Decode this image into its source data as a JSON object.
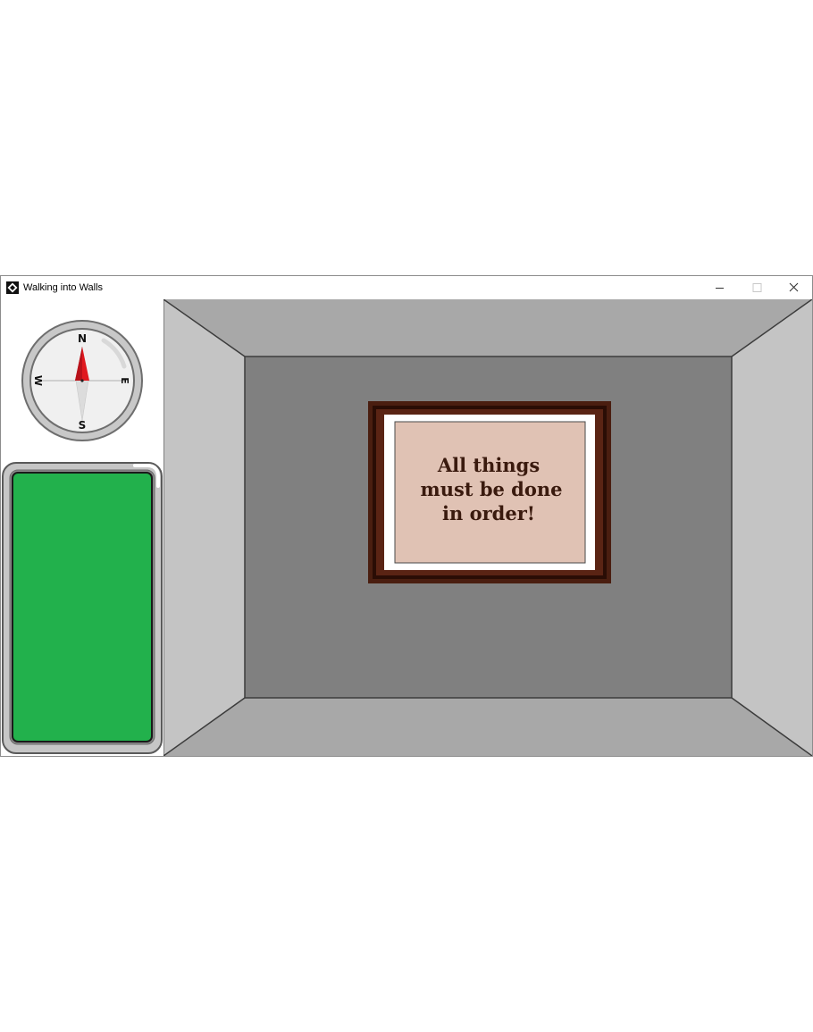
{
  "window": {
    "title": "Walking into Walls",
    "controls": {
      "minimize": "minimize",
      "maximize": "maximize",
      "close": "close"
    }
  },
  "compass": {
    "north": "N",
    "south": "S",
    "east": "E",
    "west": "W",
    "heading": "N"
  },
  "health": {
    "level": 1.0,
    "color": "#22b14c"
  },
  "room": {
    "wall_color": "#808080",
    "ceiling_color": "#a8a8a8",
    "side_color": "#c4c4c4",
    "sign": {
      "line1": "All things",
      "line2": "must be done",
      "line3": "in order!"
    }
  }
}
